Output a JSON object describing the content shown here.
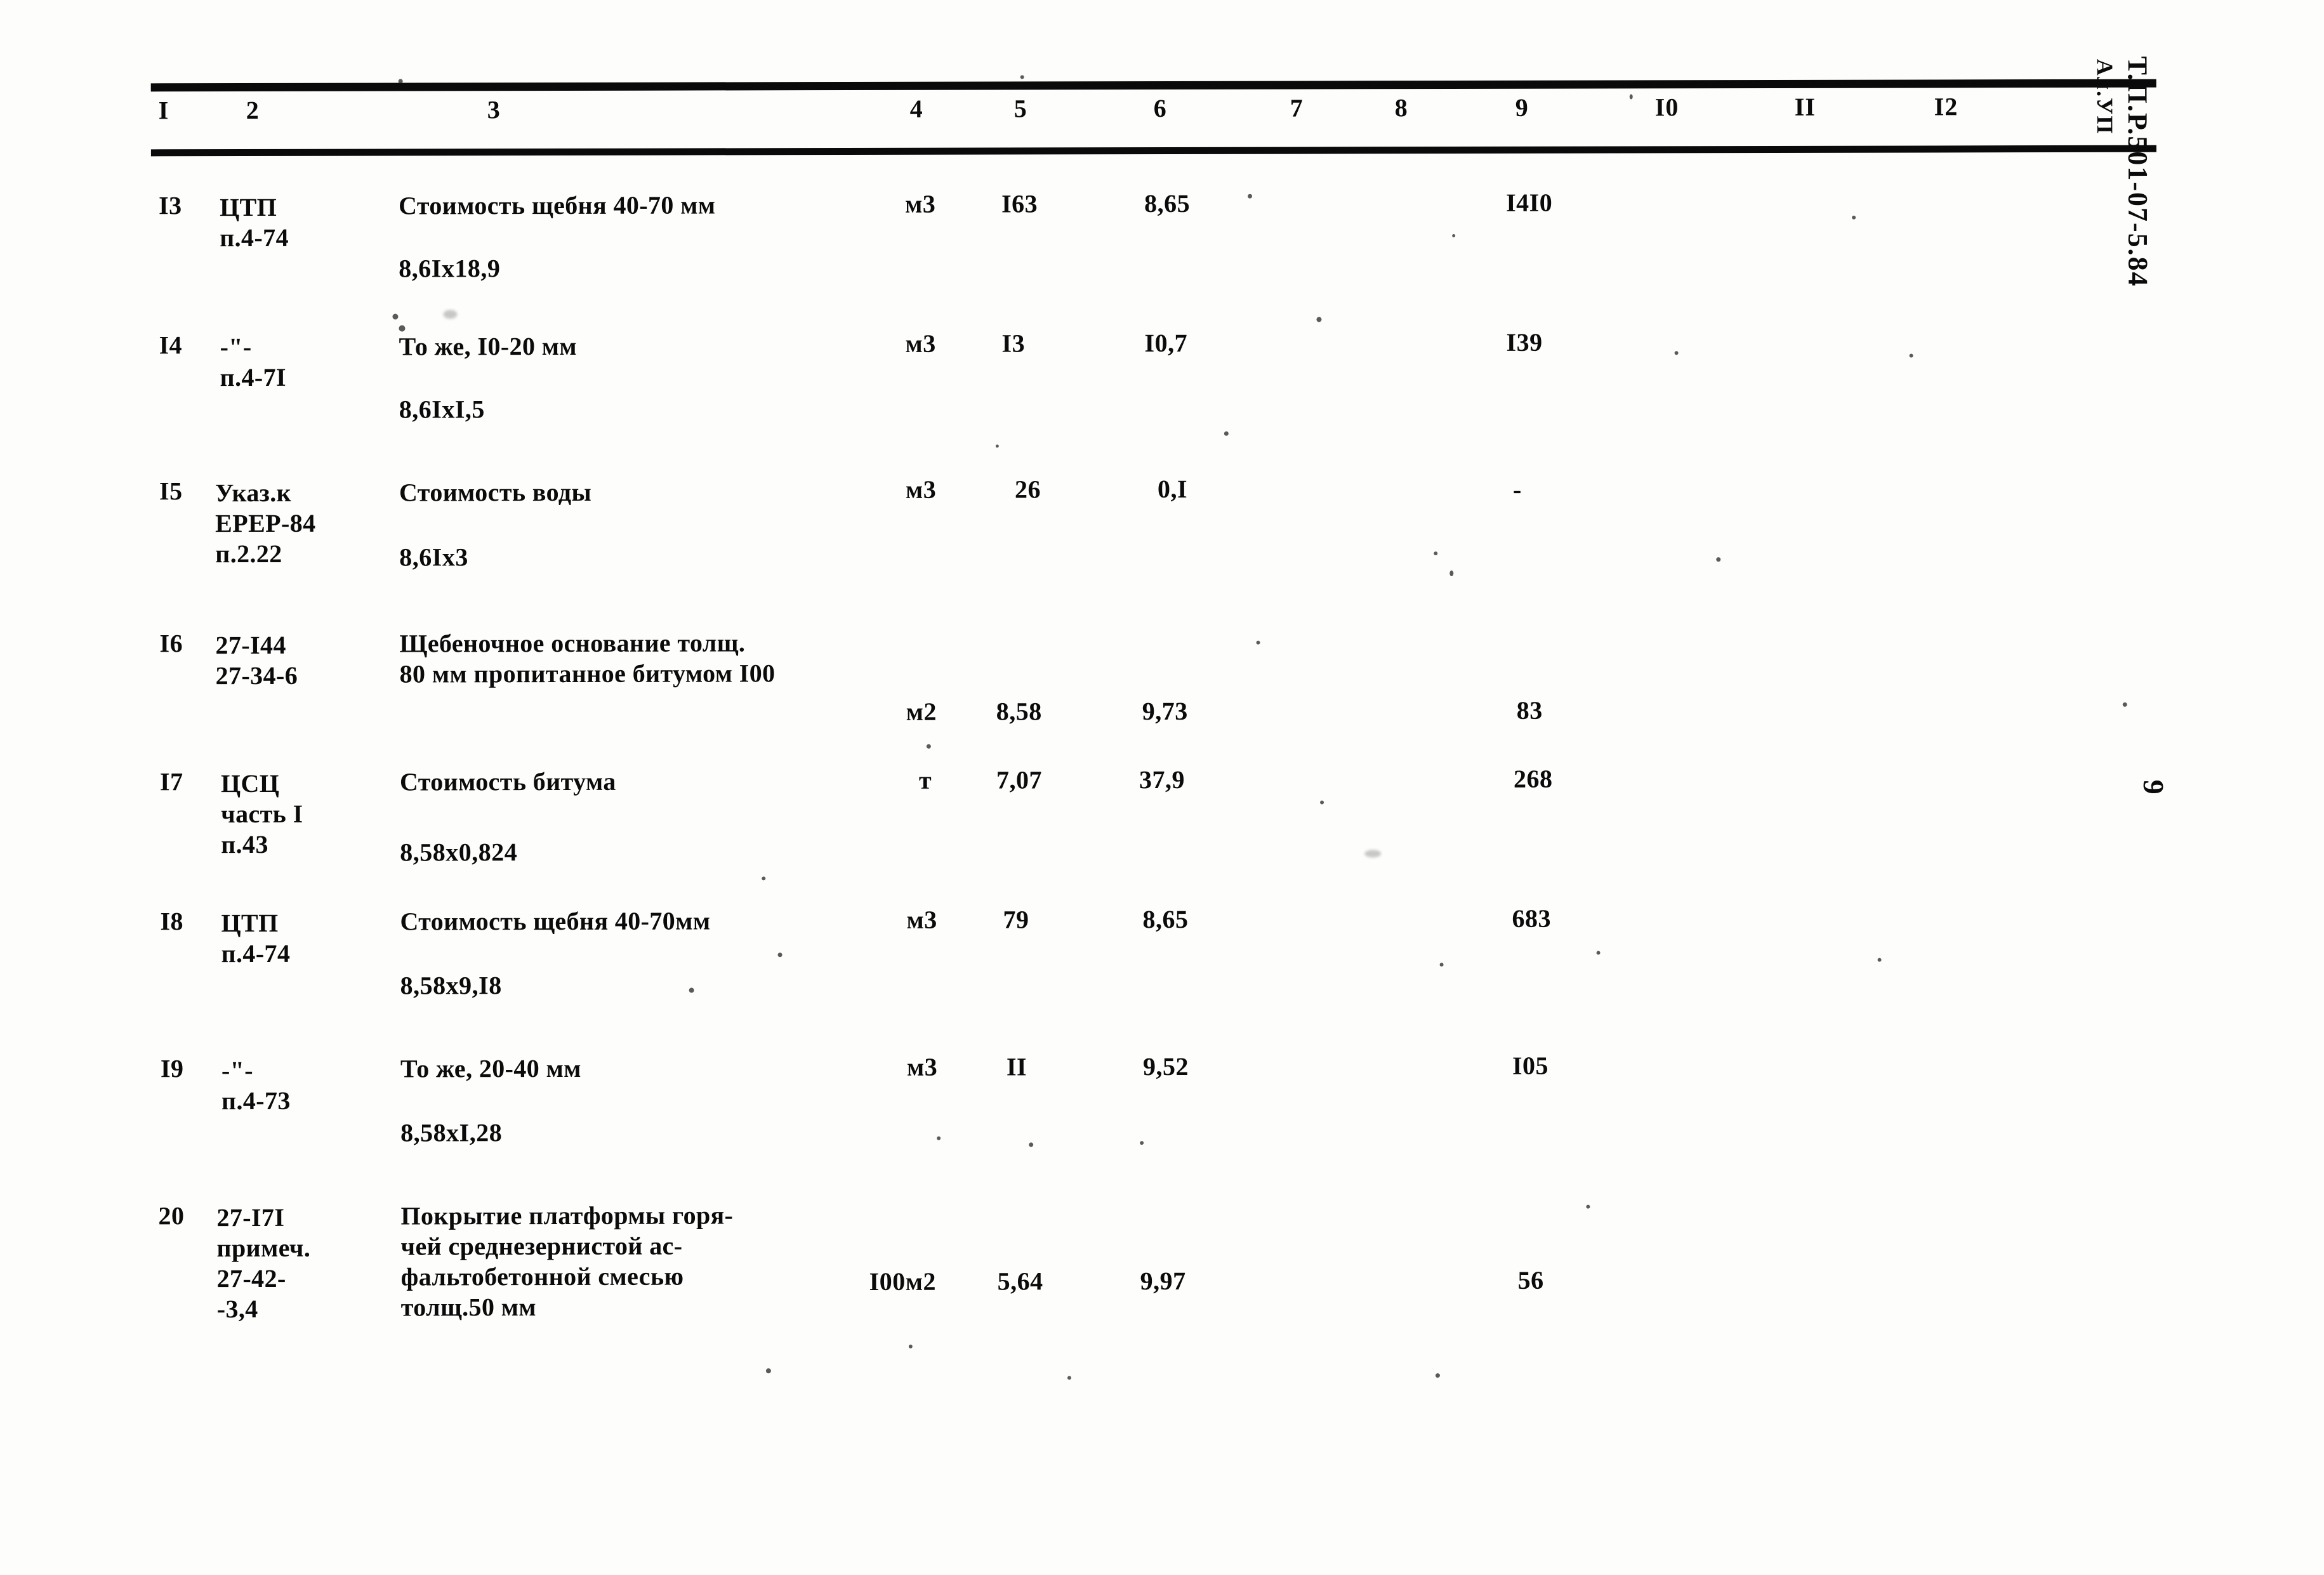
{
  "document": {
    "margin_code": "Т.П.Р.501-07-5.84",
    "margin_album": "Ал.УП",
    "page_number": "9"
  },
  "table": {
    "column_headers": [
      "I",
      "2",
      "3",
      "4",
      "5",
      "6",
      "7",
      "8",
      "9",
      "I0",
      "II",
      "I2"
    ],
    "rows": [
      {
        "num": "I3",
        "ref": "ЦТП\nп.4-74",
        "description": "Стоимость щебня 40-70 мм",
        "formula": "8,6Iх18,9",
        "unit": "м3",
        "qty": "I63",
        "price": "8,65",
        "c7": "",
        "c8": "",
        "total": "I4I0",
        "c10": "",
        "c11": "",
        "c12": ""
      },
      {
        "num": "I4",
        "ref": "-\"-\nп.4-7I",
        "description": "То же, I0-20 мм",
        "formula": "8,6IхI,5",
        "unit": "м3",
        "qty": "I3",
        "price": "I0,7",
        "c7": "",
        "c8": "",
        "total": "I39",
        "c10": "",
        "c11": "",
        "c12": ""
      },
      {
        "num": "I5",
        "ref": "Указ.к\nЕРЕР-84\nп.2.22",
        "description": "Стоимость воды",
        "formula": "8,6Iх3",
        "unit": "м3",
        "qty": "26",
        "price": "0,I",
        "c7": "",
        "c8": "",
        "total": "-",
        "c10": "",
        "c11": "",
        "c12": ""
      },
      {
        "num": "I6",
        "ref": "27-I44\n27-34-6",
        "description": "Щебеночное основание толщ.\n80 мм пропитанное битумом I00",
        "formula": "",
        "unit": "м2",
        "qty": "8,58",
        "price": "9,73",
        "c7": "",
        "c8": "",
        "total": "83",
        "c10": "",
        "c11": "",
        "c12": ""
      },
      {
        "num": "I7",
        "ref": "ЦСЦ\nчасть I\nп.43",
        "description": "Стоимость битума",
        "formula": "8,58х0,824",
        "unit": "т",
        "qty": "7,07",
        "price": "37,9",
        "c7": "",
        "c8": "",
        "total": "268",
        "c10": "",
        "c11": "",
        "c12": ""
      },
      {
        "num": "I8",
        "ref": "ЦТП\nп.4-74",
        "description": "Стоимость щебня 40-70мм",
        "formula": "8,58х9,I8",
        "unit": "м3",
        "qty": "79",
        "price": "8,65",
        "c7": "",
        "c8": "",
        "total": "683",
        "c10": "",
        "c11": "",
        "c12": ""
      },
      {
        "num": "I9",
        "ref": "-\"-\nп.4-73",
        "description": "То же, 20-40 мм",
        "formula": "8,58хI,28",
        "unit": "м3",
        "qty": "II",
        "price": "9,52",
        "c7": "",
        "c8": "",
        "total": "I05",
        "c10": "",
        "c11": "",
        "c12": ""
      },
      {
        "num": "20",
        "ref": "27-I7I\nпримеч.\n27-42-\n-3,4",
        "description": "Покрытие платформы горя-\nчей среднезернистой ас-\nфальтобетонной смесью\nтолщ.50 мм",
        "formula": "",
        "unit": "I00м2",
        "qty": "5,64",
        "price": "9,97",
        "c7": "",
        "c8": "",
        "total": "56",
        "c10": "",
        "c11": "",
        "c12": ""
      }
    ]
  }
}
